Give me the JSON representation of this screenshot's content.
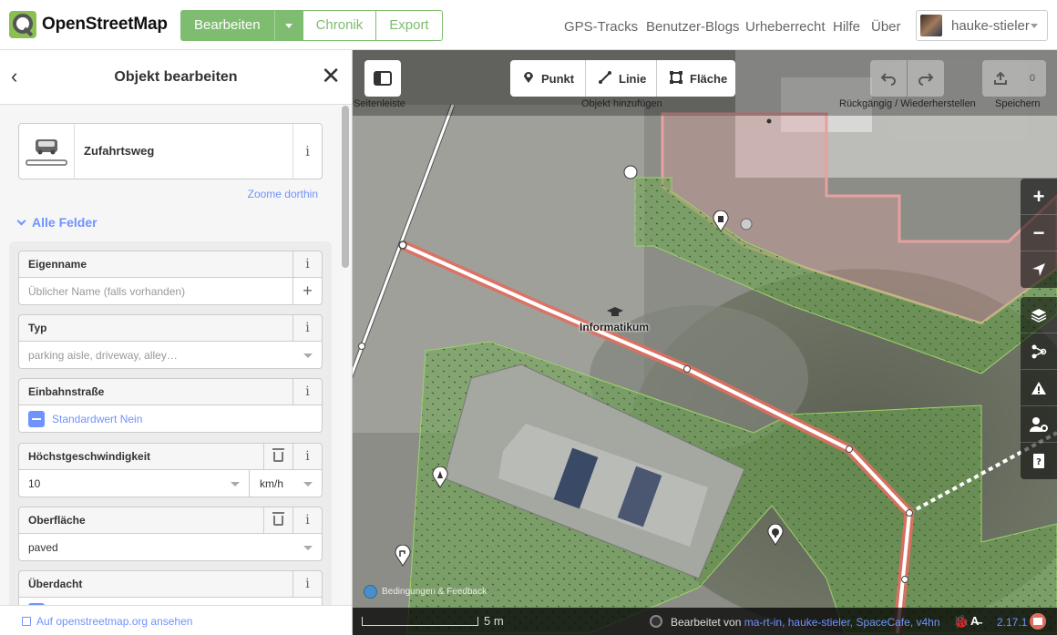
{
  "app": {
    "logo_text": "OpenStreetMap"
  },
  "navbar": {
    "edit_label": "Bearbeiten",
    "history_label": "Chronik",
    "export_label": "Export",
    "links": [
      "GPS-Tracks",
      "Benutzer-Blogs",
      "Urheberrecht",
      "Hilfe",
      "Über"
    ],
    "user_name": "hauke-stieler",
    "accent": "#7ebc6f"
  },
  "sidebar": {
    "title": "Objekt bearbeiten",
    "preset_name": "Zufahrtsweg",
    "zoom_to": "Zoome dorthin",
    "all_fields": "Alle Felder",
    "footer_link": "Auf openstreetmap.org ansehen",
    "fields": {
      "name": {
        "label": "Eigenname",
        "placeholder": "Üblicher Name (falls vorhanden)"
      },
      "type": {
        "label": "Typ",
        "placeholder": "parking aisle, driveway, alley…"
      },
      "oneway": {
        "label": "Einbahnstraße",
        "value": "Standardwert Nein"
      },
      "maxspeed": {
        "label": "Höchstgeschwindigkeit",
        "value": "10",
        "unit": "km/h"
      },
      "surface": {
        "label": "Oberfläche",
        "value": "paved"
      },
      "covered": {
        "label": "Überdacht"
      }
    },
    "info_glyph": "i"
  },
  "map": {
    "toolbar": {
      "sidebar_caption": "Seitenleiste",
      "point": "Punkt",
      "line": "Linie",
      "area": "Fläche",
      "add_caption": "Objekt hinzufügen",
      "undo_caption": "Rückgängig / Wiederherstellen",
      "save_caption": "Speichern",
      "save_count": "0"
    },
    "label": "Informatikum",
    "terms": "Bedingungen & Feedback",
    "scale": "5 m",
    "edited_by_prefix": "Bearbeitet von",
    "edited_by_users": "ma-rt-in, hauke-stieler, SpaceCafe, v4hn",
    "version": "2.17.1",
    "selected_color": "#e06e5f"
  }
}
